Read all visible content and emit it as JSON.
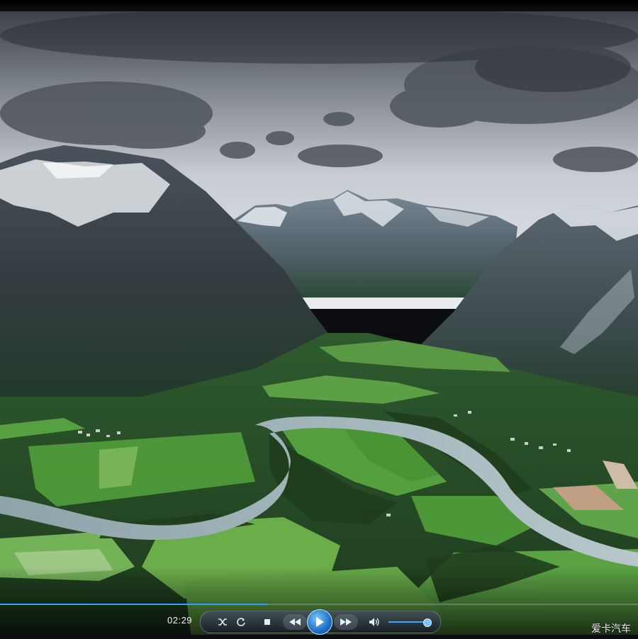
{
  "player": {
    "elapsed_time": "02:29",
    "progress_fraction": 0.42,
    "volume_fraction": 0.9,
    "watermark": "爱卡汽车"
  },
  "controls": {
    "shuffle_icon": "shuffle-icon",
    "repeat_icon": "repeat-icon",
    "stop_icon": "stop-icon",
    "previous_icon": "rewind-icon",
    "play_icon": "play-icon",
    "next_icon": "fast-forward-icon",
    "volume_icon": "speaker-icon"
  },
  "colors": {
    "accent": "#2aa3ff",
    "control_bar": "#2a323c"
  }
}
